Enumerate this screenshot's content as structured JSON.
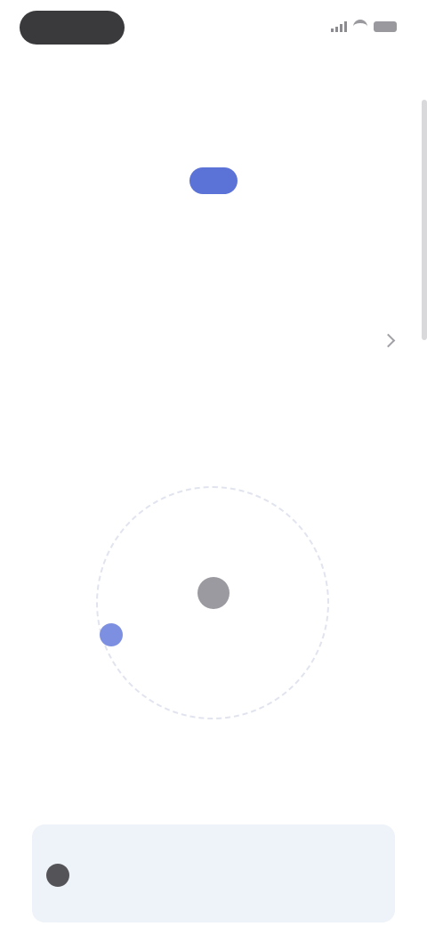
{
  "status_bar": {
    "pill_text": ""
  },
  "header": {
    "title": ""
  },
  "balance": {
    "label": "",
    "value": ""
  },
  "row_link": {
    "label": ""
  },
  "section": {
    "title": ""
  },
  "orbit": {
    "center_text": ""
  },
  "description": {
    "text": ""
  },
  "cta": {
    "label": ""
  },
  "banner": {
    "text": "",
    "link_label": ""
  },
  "colors": {
    "accent": "#6f86e0",
    "coin": "#5b72d6",
    "banner_bg": "#eef2f9"
  },
  "icons": {
    "coin": "coin-icon",
    "chevron": "chevron-right-icon",
    "orbit_center": "user-icon",
    "orbit_dot": "dot-icon",
    "banner": "info-icon"
  }
}
